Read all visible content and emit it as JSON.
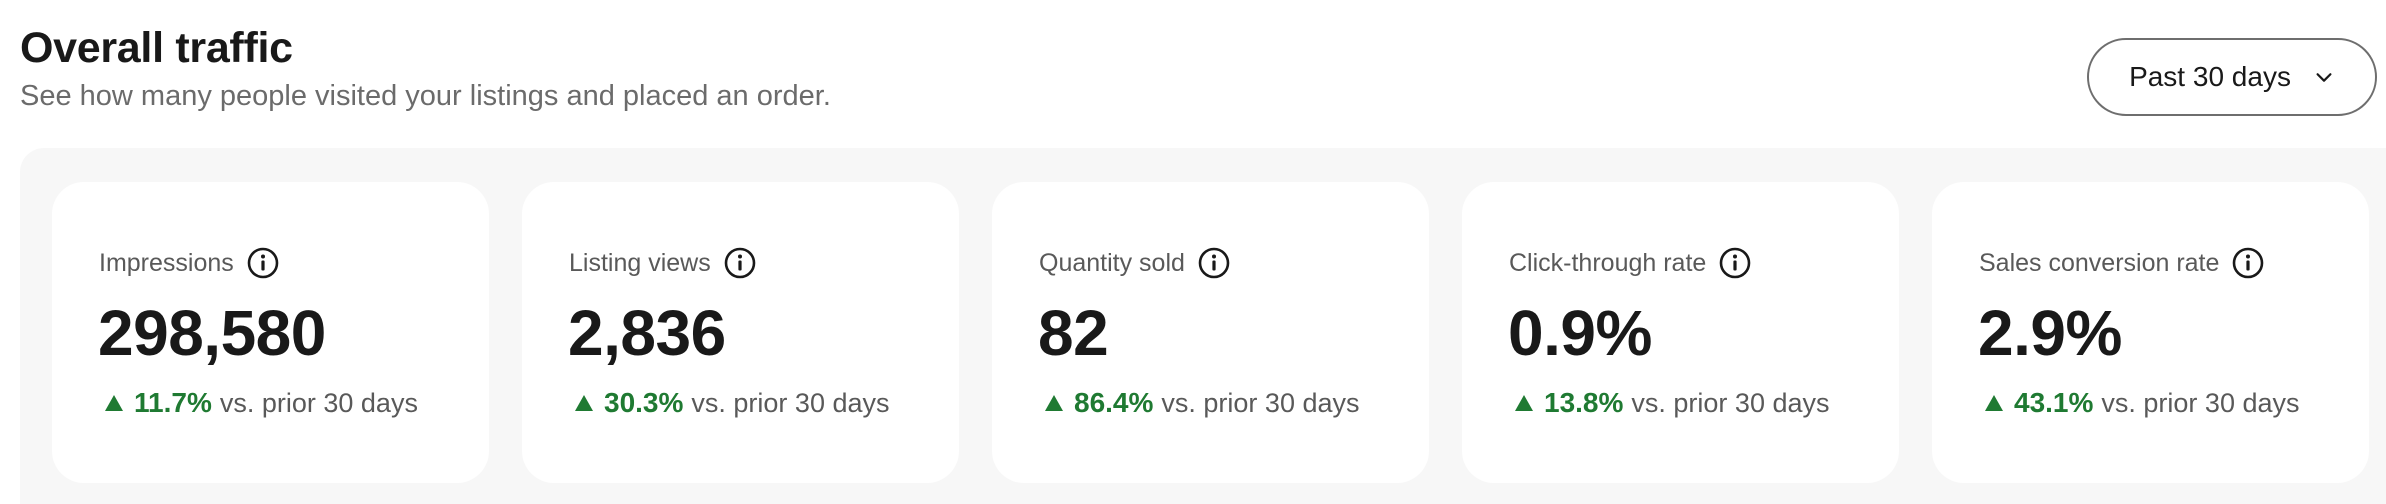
{
  "header": {
    "title": "Overall traffic",
    "subtitle": "See how many people visited your listings and placed an order.",
    "range_label": "Past 30 days"
  },
  "colors": {
    "positive": "#1f7a32",
    "panel_bg": "#f7f7f7"
  },
  "icons": {
    "info": "info-circle-icon",
    "chevron": "chevron-down-icon",
    "trend": "triangle-up-icon"
  },
  "metrics": [
    {
      "label": "Impressions",
      "value": "298,580",
      "change": "11.7%",
      "comparison": "vs. prior 30 days"
    },
    {
      "label": "Listing views",
      "value": "2,836",
      "change": "30.3%",
      "comparison": "vs. prior 30 days"
    },
    {
      "label": "Quantity sold",
      "value": "82",
      "change": "86.4%",
      "comparison": "vs. prior 30 days"
    },
    {
      "label": "Click-through rate",
      "value": "0.9%",
      "change": "13.8%",
      "comparison": "vs. prior 30 days"
    },
    {
      "label": "Sales conversion rate",
      "value": "2.9%",
      "change": "43.1%",
      "comparison": "vs. prior 30 days"
    }
  ]
}
